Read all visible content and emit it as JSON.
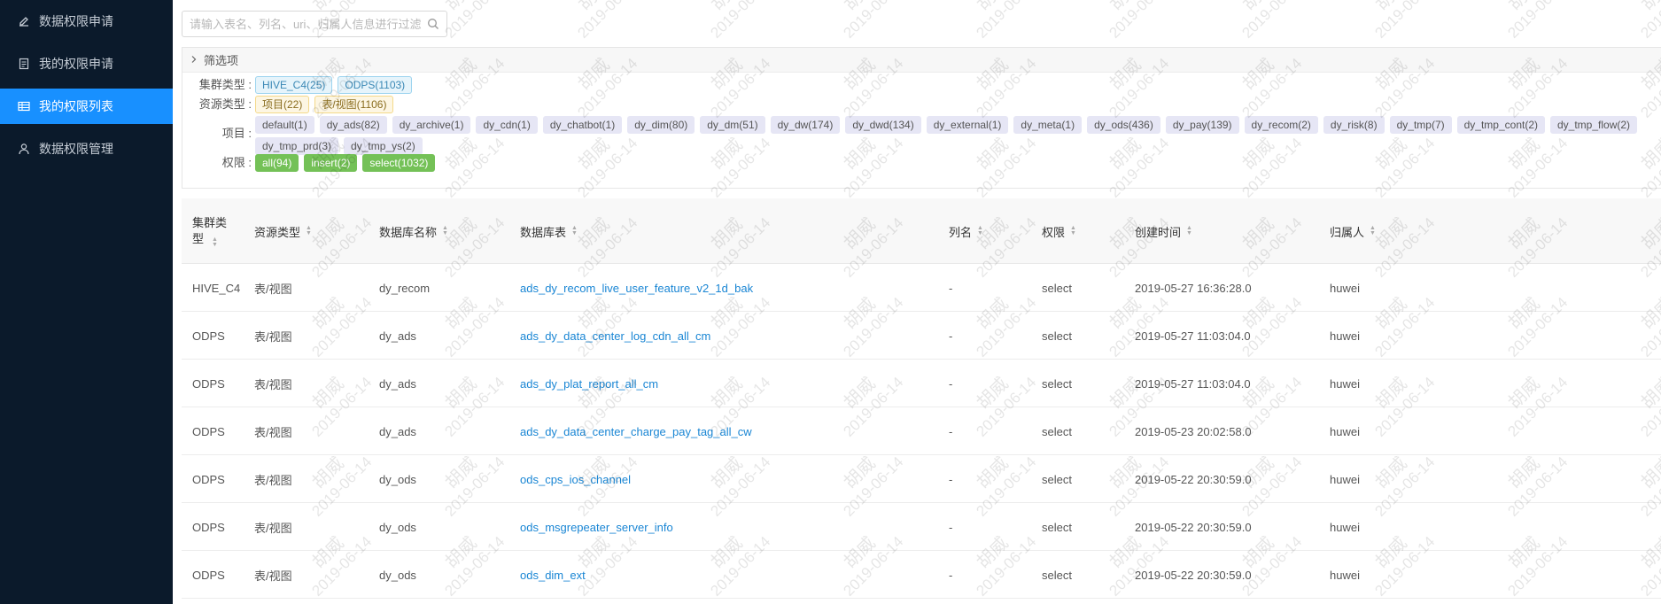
{
  "sidebar": {
    "items": [
      {
        "label": "数据权限申请",
        "icon": "edit-icon"
      },
      {
        "label": "我的权限申请",
        "icon": "document-icon"
      },
      {
        "label": "我的权限列表",
        "icon": "table-icon",
        "active": true
      },
      {
        "label": "数据权限管理",
        "icon": "user-icon"
      }
    ]
  },
  "search": {
    "placeholder": "请输入表名、列名、uri、归属人信息进行过滤",
    "value": ""
  },
  "filters": {
    "title": "筛选项",
    "cluster": {
      "label": "集群类型 :",
      "tags": [
        "HIVE_C4(25)",
        "ODPS(1103)"
      ]
    },
    "resource": {
      "label": "资源类型 :",
      "tags": [
        "项目(22)",
        "表/视图(1106)"
      ]
    },
    "project": {
      "label": "项目 :",
      "tags": [
        "default(1)",
        "dy_ads(82)",
        "dy_archive(1)",
        "dy_cdn(1)",
        "dy_chatbot(1)",
        "dy_dim(80)",
        "dy_dm(51)",
        "dy_dw(174)",
        "dy_dwd(134)",
        "dy_external(1)",
        "dy_meta(1)",
        "dy_ods(436)",
        "dy_pay(139)",
        "dy_recom(2)",
        "dy_risk(8)",
        "dy_tmp(7)",
        "dy_tmp_cont(2)",
        "dy_tmp_flow(2)",
        "dy_tmp_prd(3)",
        "dy_tmp_ys(2)"
      ]
    },
    "permission": {
      "label": "权限 :",
      "tags": [
        "all(94)",
        "insert(2)",
        "select(1032)"
      ]
    }
  },
  "table": {
    "columns": [
      "集群类型",
      "资源类型",
      "数据库名称",
      "数据库表",
      "列名",
      "权限",
      "创建时间",
      "归属人"
    ],
    "rows": [
      [
        "HIVE_C4",
        "表/视图",
        "dy_recom",
        "ads_dy_recom_live_user_feature_v2_1d_bak",
        "-",
        "select",
        "2019-05-27 16:36:28.0",
        "huwei"
      ],
      [
        "ODPS",
        "表/视图",
        "dy_ads",
        "ads_dy_data_center_log_cdn_all_cm",
        "-",
        "select",
        "2019-05-27 11:03:04.0",
        "huwei"
      ],
      [
        "ODPS",
        "表/视图",
        "dy_ads",
        "ads_dy_plat_report_all_cm",
        "-",
        "select",
        "2019-05-27 11:03:04.0",
        "huwei"
      ],
      [
        "ODPS",
        "表/视图",
        "dy_ads",
        "ads_dy_data_center_charge_pay_tag_all_cw",
        "-",
        "select",
        "2019-05-23 20:02:58.0",
        "huwei"
      ],
      [
        "ODPS",
        "表/视图",
        "dy_ods",
        "ods_cps_ios_channel",
        "-",
        "select",
        "2019-05-22 20:30:59.0",
        "huwei"
      ],
      [
        "ODPS",
        "表/视图",
        "dy_ods",
        "ods_msgrepeater_server_info",
        "-",
        "select",
        "2019-05-22 20:30:59.0",
        "huwei"
      ],
      [
        "ODPS",
        "表/视图",
        "dy_ods",
        "ods_dim_ext",
        "-",
        "select",
        "2019-05-22 20:30:59.0",
        "huwei"
      ]
    ]
  },
  "watermark": {
    "name": "胡威",
    "date": "2019-06-14"
  }
}
